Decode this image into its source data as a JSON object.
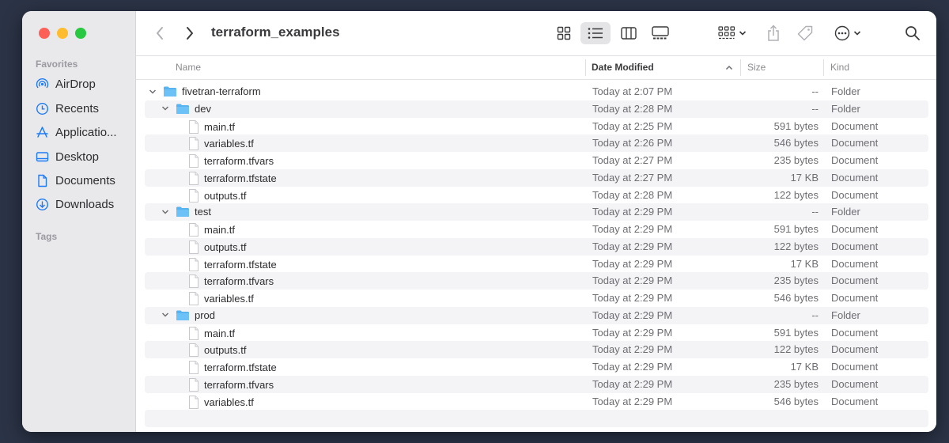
{
  "sidebar": {
    "favorites_heading": "Favorites",
    "items": [
      {
        "label": "AirDrop",
        "icon": "airdrop-icon"
      },
      {
        "label": "Recents",
        "icon": "clock-icon"
      },
      {
        "label": "Applicatio...",
        "icon": "applications-icon"
      },
      {
        "label": "Desktop",
        "icon": "desktop-icon"
      },
      {
        "label": "Documents",
        "icon": "document-icon"
      },
      {
        "label": "Downloads",
        "icon": "downloads-icon"
      }
    ],
    "tags_heading": "Tags"
  },
  "toolbar": {
    "title": "terraform_examples",
    "active_view": "list"
  },
  "columns": {
    "name": "Name",
    "date": "Date Modified",
    "size": "Size",
    "kind": "Kind"
  },
  "rows": [
    {
      "name": "fivetran-terraform",
      "date": "Today at 2:07 PM",
      "size": "--",
      "kind": "Folder"
    },
    {
      "name": "dev",
      "date": "Today at 2:28 PM",
      "size": "--",
      "kind": "Folder"
    },
    {
      "name": "main.tf",
      "date": "Today at 2:25 PM",
      "size": "591 bytes",
      "kind": "Document"
    },
    {
      "name": "variables.tf",
      "date": "Today at 2:26 PM",
      "size": "546 bytes",
      "kind": "Document"
    },
    {
      "name": "terraform.tfvars",
      "date": "Today at 2:27 PM",
      "size": "235 bytes",
      "kind": "Document"
    },
    {
      "name": "terraform.tfstate",
      "date": "Today at 2:27 PM",
      "size": "17 KB",
      "kind": "Document"
    },
    {
      "name": "outputs.tf",
      "date": "Today at 2:28 PM",
      "size": "122 bytes",
      "kind": "Document"
    },
    {
      "name": "test",
      "date": "Today at 2:29 PM",
      "size": "--",
      "kind": "Folder"
    },
    {
      "name": "main.tf",
      "date": "Today at 2:29 PM",
      "size": "591 bytes",
      "kind": "Document"
    },
    {
      "name": "outputs.tf",
      "date": "Today at 2:29 PM",
      "size": "122 bytes",
      "kind": "Document"
    },
    {
      "name": "terraform.tfstate",
      "date": "Today at 2:29 PM",
      "size": "17 KB",
      "kind": "Document"
    },
    {
      "name": "terraform.tfvars",
      "date": "Today at 2:29 PM",
      "size": "235 bytes",
      "kind": "Document"
    },
    {
      "name": "variables.tf",
      "date": "Today at 2:29 PM",
      "size": "546 bytes",
      "kind": "Document"
    },
    {
      "name": "prod",
      "date": "Today at 2:29 PM",
      "size": "--",
      "kind": "Folder"
    },
    {
      "name": "main.tf",
      "date": "Today at 2:29 PM",
      "size": "591 bytes",
      "kind": "Document"
    },
    {
      "name": "outputs.tf",
      "date": "Today at 2:29 PM",
      "size": "122 bytes",
      "kind": "Document"
    },
    {
      "name": "terraform.tfstate",
      "date": "Today at 2:29 PM",
      "size": "17 KB",
      "kind": "Document"
    },
    {
      "name": "terraform.tfvars",
      "date": "Today at 2:29 PM",
      "size": "235 bytes",
      "kind": "Document"
    },
    {
      "name": "variables.tf",
      "date": "Today at 2:29 PM",
      "size": "546 bytes",
      "kind": "Document"
    }
  ],
  "colors": {
    "accent": "#1d7bf5",
    "folder": "#56b2f0"
  }
}
